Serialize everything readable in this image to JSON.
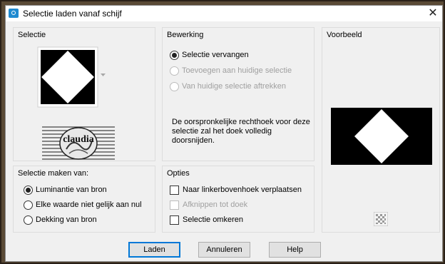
{
  "window": {
    "title": "Selectie laden vanaf schijf",
    "close_glyph": "✕"
  },
  "selectie": {
    "label": "Selectie",
    "thumbnail_text": "claudia"
  },
  "bewerking": {
    "label": "Bewerking",
    "options": [
      {
        "label": "Selectie vervangen",
        "selected": true,
        "enabled": true
      },
      {
        "label": "Toevoegen aan huidige selectie",
        "selected": false,
        "enabled": false
      },
      {
        "label": "Van huidige selectie aftrekken",
        "selected": false,
        "enabled": false
      }
    ],
    "description": "De oorspronkelijke rechthoek voor deze selectie zal het doek volledig doorsnijden."
  },
  "voorbeeld": {
    "label": "Voorbeeld"
  },
  "selectie_maken": {
    "label": "Selectie maken van:",
    "options": [
      {
        "label": "Luminantie van bron",
        "selected": true
      },
      {
        "label": "Elke waarde niet gelijk aan nul",
        "selected": false
      },
      {
        "label": "Dekking van bron",
        "selected": false
      }
    ]
  },
  "opties": {
    "label": "Opties",
    "items": [
      {
        "label": "Naar linkerbovenhoek verplaatsen",
        "checked": false,
        "enabled": true
      },
      {
        "label": "Afknippen tot doek",
        "checked": false,
        "enabled": false
      },
      {
        "label": "Selectie omkeren",
        "checked": false,
        "enabled": true
      }
    ]
  },
  "buttons": {
    "load": "Laden",
    "cancel": "Annuleren",
    "help": "Help"
  },
  "colors": {
    "accent": "#0078d7",
    "app_icon": "#1f8ad0",
    "dialog_bg": "#f0f0f0"
  }
}
